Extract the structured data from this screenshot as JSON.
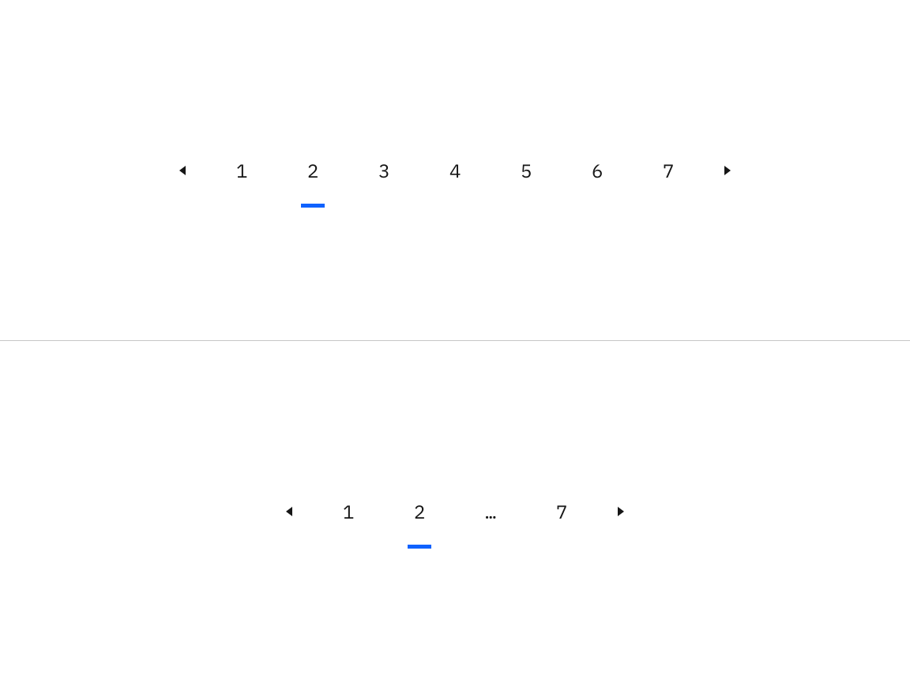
{
  "accent_color": "#0f62fe",
  "pagination_full": {
    "active_index": 1,
    "items": [
      {
        "label": "1"
      },
      {
        "label": "2"
      },
      {
        "label": "3"
      },
      {
        "label": "4"
      },
      {
        "label": "5"
      },
      {
        "label": "6"
      },
      {
        "label": "7"
      }
    ]
  },
  "pagination_truncated": {
    "active_index": 1,
    "items": [
      {
        "label": "1"
      },
      {
        "label": "2"
      },
      {
        "label": "…"
      },
      {
        "label": "7"
      }
    ]
  }
}
